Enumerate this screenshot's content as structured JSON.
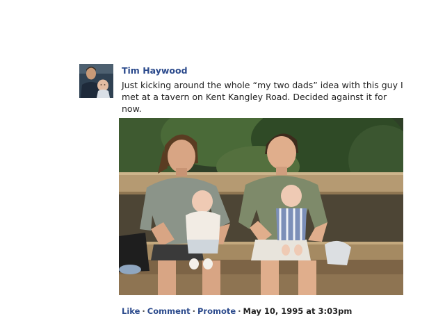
{
  "post": {
    "author": "Tim Haywood",
    "text": "Just kicking around the whole “my two dads” idea with this guy I met at a tavern on Kent Kangley Road. Decided against it for now.",
    "actions": {
      "like": "Like",
      "comment": "Comment",
      "promote": "Promote"
    },
    "separator": "·",
    "timestamp": "May 10, 1995 at 3:03pm"
  },
  "colors": {
    "link": "#2b4a8c",
    "text": "#222222",
    "background": "#ffffff"
  }
}
